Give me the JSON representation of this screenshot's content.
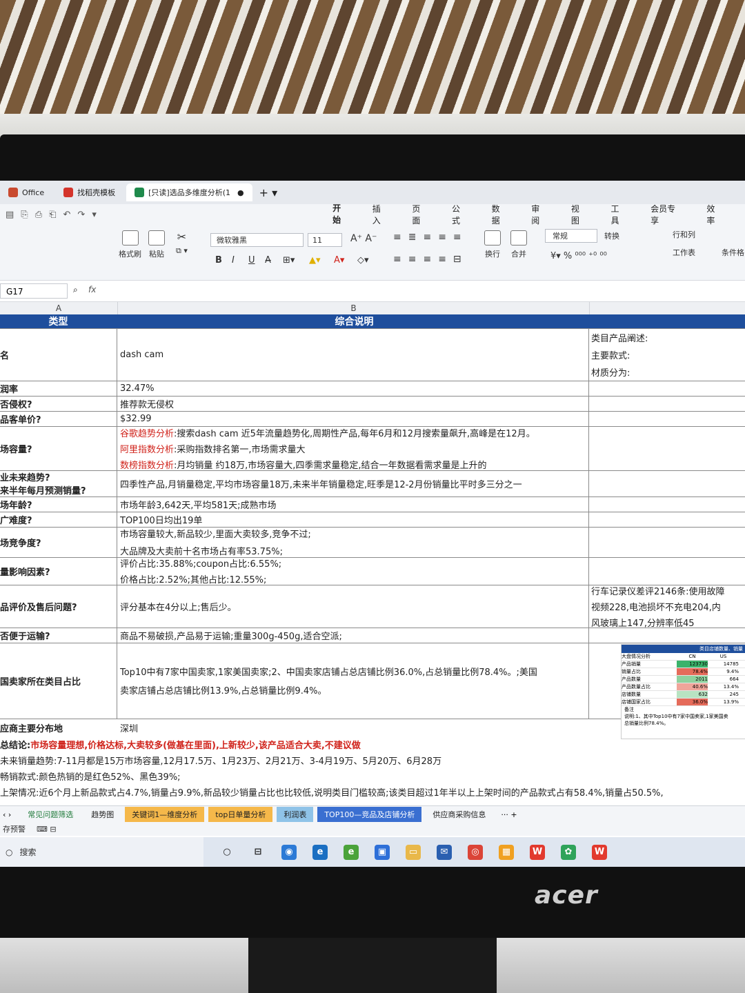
{
  "tabs": [
    {
      "label": "Office",
      "color": "#c94a2f"
    },
    {
      "label": "找稻壳模板",
      "color": "#d4342b"
    },
    {
      "label": "[只读]选品多维度分析(1",
      "color": "#1f8a4c"
    }
  ],
  "quick_access": [
    "⎙",
    "⎌",
    "⎙",
    "⎗",
    "↶",
    "↷",
    "▾"
  ],
  "menus": [
    "开始",
    "插入",
    "页面",
    "公式",
    "数据",
    "审阅",
    "视图",
    "工具",
    "会员专享",
    "效率"
  ],
  "ribbon": {
    "format_painter": "格式刷",
    "paste": "粘贴",
    "font_name": "微软雅黑",
    "font_size": "11",
    "wrap": "换行",
    "merge": "合并",
    "number_format": "常规",
    "convert": "转换",
    "rows_cols": "行和列",
    "worksheet": "工作表",
    "conditional": "条件格"
  },
  "formula_bar": {
    "cell_ref": "G17",
    "fx": "fx",
    "value": ""
  },
  "columns": [
    "A",
    "B"
  ],
  "table": {
    "header": {
      "a": "类型",
      "b": "综合说明"
    },
    "rows": [
      {
        "a": "名",
        "b": [
          "dash cam"
        ],
        "c": [
          "类目产品阐述:",
          "主要款式:",
          "材质分为:"
        ]
      },
      {
        "a": "润率",
        "b": [
          "32.47%"
        ]
      },
      {
        "a": "否侵权?",
        "b": [
          "推荐款无侵权"
        ]
      },
      {
        "a": "品客单价?",
        "b": [
          "$32.99"
        ]
      },
      {
        "a": "场容量?",
        "b_rich": [
          {
            "label": "谷歌趋势分析",
            "text": ":搜索dash cam 近5年流量趋势化,周期性产品,每年6月和12月搜索量飙升,高峰是在12月。"
          },
          {
            "label": "阿里指数分析",
            "text": ":采购指数排名第一,市场需求量大"
          },
          {
            "label": "数榜指数分析",
            "text": ":月均销量 约18万,市场容量大,四季需求量稳定,结合一年数据看需求量是上升的"
          }
        ]
      },
      {
        "a": "业未来趋势?",
        "a2": "来半年每月预测销量?",
        "b": [
          "四季性产品,月销量稳定,平均市场容量18万,未来半年销量稳定,旺季是12-2月份销量比平时多三分之一"
        ]
      },
      {
        "a": "场年龄?",
        "b": [
          "市场年龄3,642天,平均581天;成熟市场"
        ]
      },
      {
        "a": "广难度?",
        "b": [
          "TOP100日均出19单"
        ]
      },
      {
        "a": "场竞争度?",
        "b": [
          "市场容量较大,新品较少,里面大卖较多,竞争不过;",
          "大品牌及大卖前十名市场占有率53.75%;"
        ]
      },
      {
        "a": "量影响因素?",
        "b": [
          "评价占比:35.88%;coupon占比:6.55%;",
          "价格占比:2.52%;其他占比:12.55%;"
        ]
      },
      {
        "a": "品评价及售后问题?",
        "b": [
          "评分基本在4分以上;售后少。"
        ],
        "c": [
          "行车记录仪差评2146条:使用故障",
          "视频228,电池损坏不充电204,内",
          "风玻璃上147,分辨率低45"
        ]
      },
      {
        "a": "否便于运输?",
        "b": [
          "商品不易破损,产品易于运输;重量300g-450g,适合空派;"
        ]
      },
      {
        "a": "国卖家所在类目占比",
        "b": [
          "Top10中有7家中国卖家,1家美国卖家;2、中国卖家店铺占总店铺比例36.0%,占总销量比例78.4%。;美国",
          "卖家店铺占总店铺比例13.9%,占总销量比例9.4%。"
        ]
      }
    ]
  },
  "mini_table": {
    "title": "类目店铺数量、销量",
    "cols": [
      "大盘情况分析",
      "CN",
      "US"
    ],
    "rows": [
      [
        "产品销量",
        "123730",
        "14785"
      ],
      [
        "销量占比",
        "78.4%",
        "9.4%"
      ],
      [
        "产品数量",
        "2011",
        "664"
      ],
      [
        "产品数量占比",
        "40.6%",
        "13.4%"
      ],
      [
        "店铺数量",
        "632",
        "245"
      ],
      [
        "店铺国家占比",
        "36.0%",
        "13.9%"
      ]
    ],
    "note": "备注",
    "desc": "说明:1、其中Top10中有7家中国卖家,1家美国卖",
    "desc2": "总销量比例78.4%。"
  },
  "supplier_row": {
    "a": "应商主要分布地",
    "b": "深圳"
  },
  "conclusion": {
    "prefix": "总结论:",
    "text": "市场容量理想,价格达标,大卖较多(做基在里面),上新较少,该产品适合大卖,不建议做"
  },
  "lines": [
    "未来销量趋势:7-11月都是15万市场容量,12月17.5万、1月23万、2月21万、3-4月19万、5月20万、6月28万",
    "畅销款式:颜色热销的是红色52%、黑色39%;",
    "上架情况:近6个月上新品款式占4.7%,销量占9.9%,新品较少销量占比也比较低,说明类目门槛较高;该类目超过1年半以上上架时间的产品款式占有58.4%,销量占50.5%,"
  ],
  "sheet_tabs": [
    {
      "label": "常见问题筛选",
      "bg": "#f3f5f8",
      "fg": "#1f7a3a"
    },
    {
      "label": "趋势图",
      "bg": "#f3f5f8",
      "fg": "#222"
    },
    {
      "label": "关键词1—维度分析",
      "bg": "#f5b84a",
      "fg": "#222"
    },
    {
      "label": "top日单量分析",
      "bg": "#f5b84a",
      "fg": "#222"
    },
    {
      "label": "利润表",
      "bg": "#8fc3e8",
      "fg": "#222"
    },
    {
      "label": "TOP100—竞品及店铺分析",
      "bg": "#3a6fd1",
      "fg": "#fff"
    },
    {
      "label": "供应商采购信息",
      "bg": "#f3f5f8",
      "fg": "#222"
    }
  ],
  "statusbar": {
    "left": "存预警",
    "icons": "⌨ ⊟"
  },
  "taskbar": {
    "search": "搜索"
  },
  "brand": "acer"
}
